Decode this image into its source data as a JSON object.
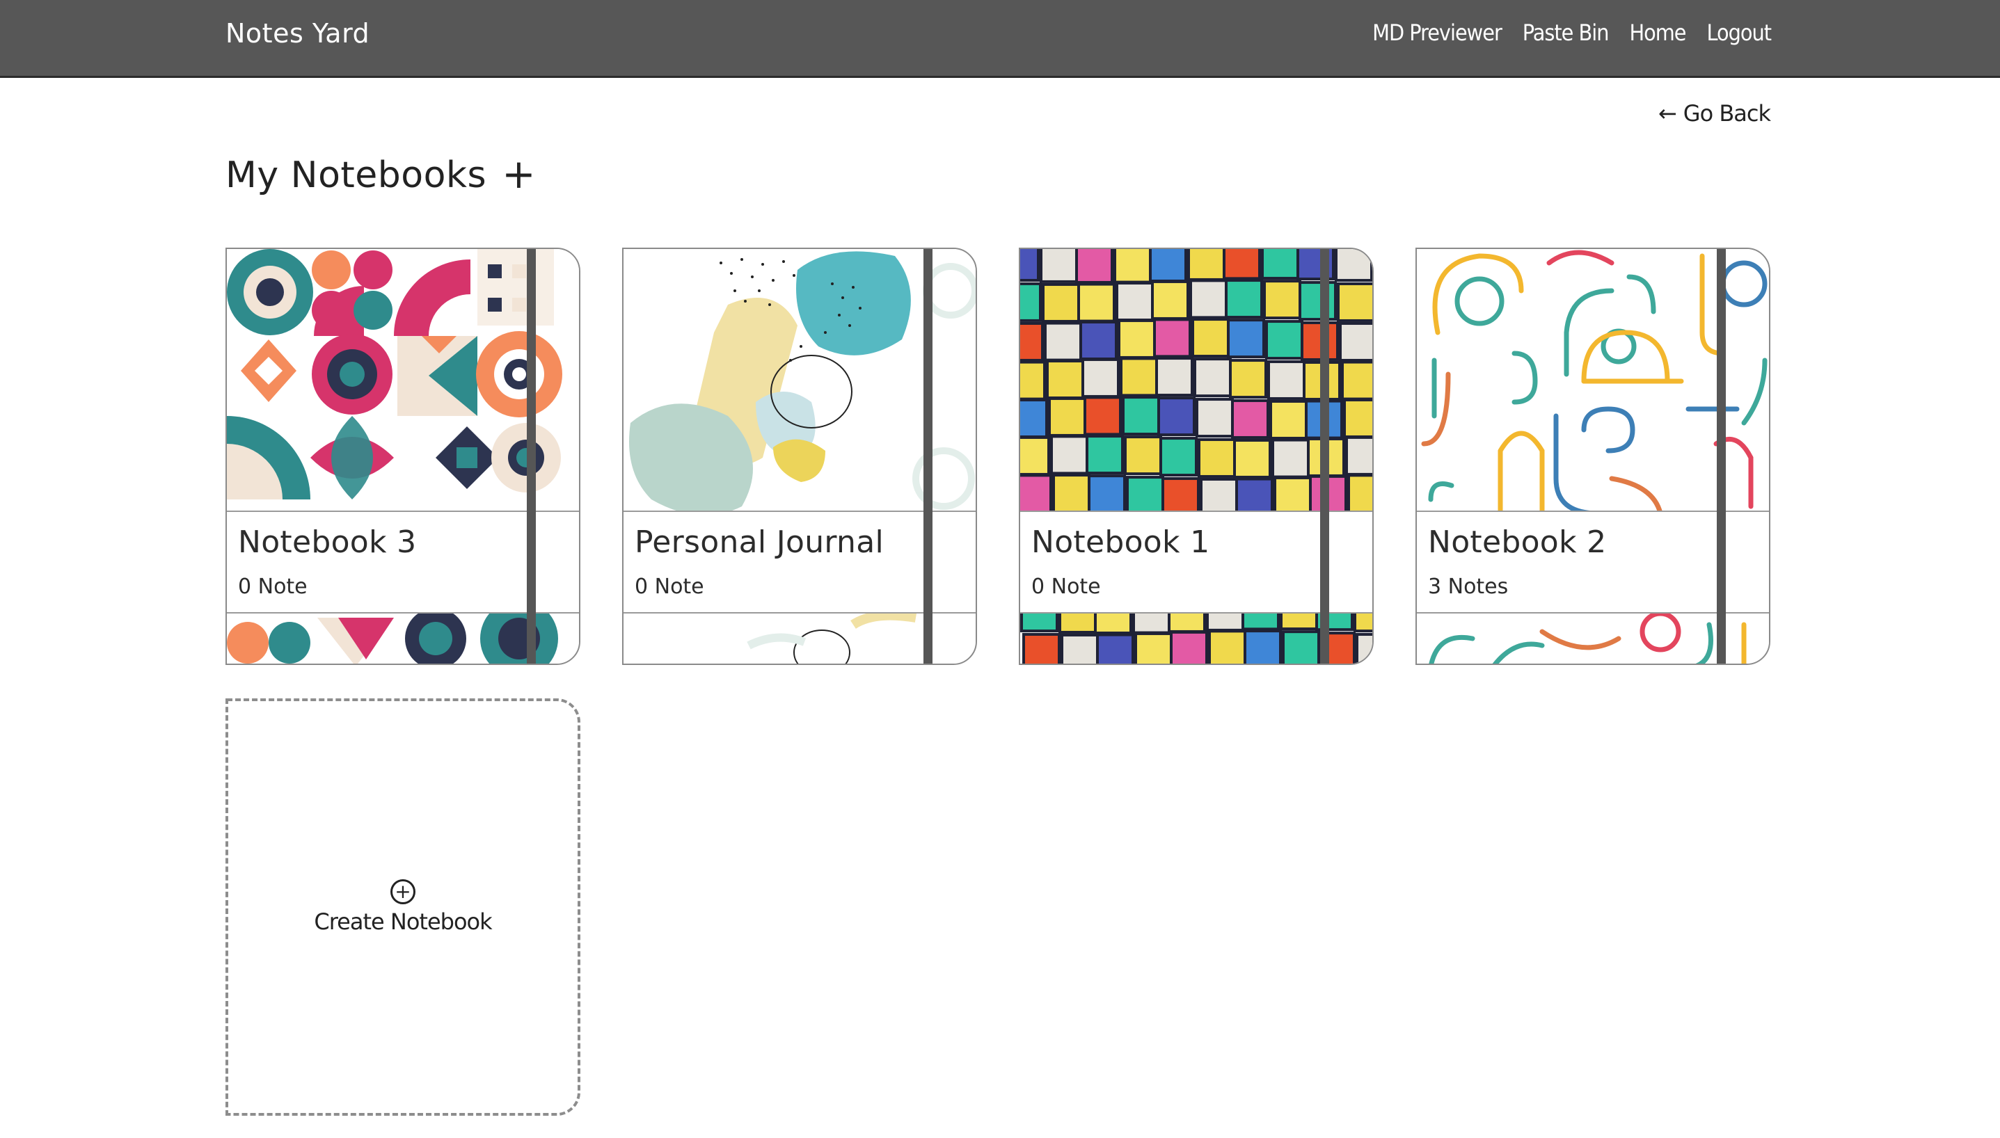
{
  "navbar": {
    "brand": "Notes Yard",
    "links": [
      "MD Previewer",
      "Paste Bin",
      "Home",
      "Logout"
    ]
  },
  "go_back": {
    "icon": "arrow-left-icon",
    "label": "Go Back"
  },
  "page": {
    "title": "My Notebooks",
    "add_icon": "plus-icon"
  },
  "notebooks": [
    {
      "title": "Notebook 3",
      "count": "0 Note",
      "cover": "geometric-shapes-pattern"
    },
    {
      "title": "Personal Journal",
      "count": "0 Note",
      "cover": "abstract-blobs-pattern"
    },
    {
      "title": "Notebook 1",
      "count": "0 Note",
      "cover": "colorful-grid-pattern"
    },
    {
      "title": "Notebook 2",
      "count": "3 Notes",
      "cover": "curved-lines-pattern"
    }
  ],
  "create_card": {
    "icon": "add-circle-icon",
    "label": "Create Notebook"
  },
  "colors": {
    "navbar": "#575757",
    "strap": "#565656",
    "background": "#ffffff"
  }
}
